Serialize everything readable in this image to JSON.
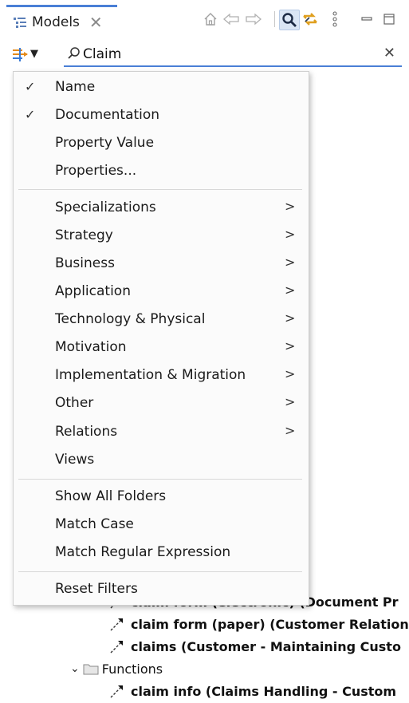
{
  "tab": {
    "icon": "model-tree-icon",
    "label": "Models",
    "close": "✕"
  },
  "toolbar": {
    "icons": [
      "home-icon",
      "back-icon",
      "forward-icon",
      "search-icon",
      "link-sync-icon",
      "view-menu-icon",
      "minimize-icon",
      "maximize-icon"
    ],
    "accent": "#4a7fd6",
    "search_active_bg": "#dbe6f5"
  },
  "filter": {
    "icon": "filter-icon",
    "search_value": "Claim",
    "clear": "✕"
  },
  "menu": {
    "items": [
      {
        "label": "Name",
        "checked": "✓"
      },
      {
        "label": "Documentation",
        "checked": "✓"
      },
      {
        "label": "Property Value",
        "checked": ""
      },
      {
        "label": "Properties...",
        "checked": ""
      },
      {
        "label": "Specializations",
        "submenu": ">"
      },
      {
        "label": "Strategy",
        "submenu": ">"
      },
      {
        "label": "Business",
        "submenu": ">"
      },
      {
        "label": "Application",
        "submenu": ">"
      },
      {
        "label": "Technology & Physical",
        "submenu": ">"
      },
      {
        "label": "Motivation",
        "submenu": ">"
      },
      {
        "label": "Implementation & Migration",
        "submenu": ">"
      },
      {
        "label": "Other",
        "submenu": ">"
      },
      {
        "label": "Relations",
        "submenu": ">"
      },
      {
        "label": "Views",
        "submenu": ""
      },
      {
        "label": "Show All Folders",
        "submenu": ""
      },
      {
        "label": "Match Case",
        "submenu": ""
      },
      {
        "label": "Match Regular Expression",
        "submenu": ""
      },
      {
        "label": "Reset Filters",
        "submenu": ""
      }
    ]
  },
  "tree": {
    "rows": [
      {
        "label": "claim form (electronic) (Document Pr"
      },
      {
        "label": "claim form (paper) (Customer Relation"
      },
      {
        "label": "claims (Customer - Maintaining Custo"
      },
      {
        "label": "Functions",
        "chevron": "⌄"
      },
      {
        "label": "claim info (Claims Handling - Custom"
      }
    ]
  }
}
